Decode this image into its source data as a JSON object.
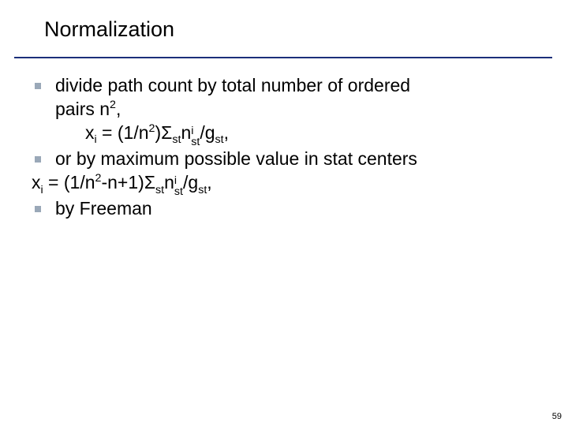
{
  "title": "Normalization",
  "bullets": {
    "b1_l1": "divide path count by total number of ordered",
    "b1_l2_prefix": "pairs n",
    "b1_l2_sup": "2",
    "b1_l2_suffix": ",",
    "f1_prefix": "x",
    "f1_i": "i",
    "f1_eq": " = (1/n",
    "f1_n2": "2",
    "f1_rpar": ")",
    "f1_sigma": "Σ",
    "f1_sig_sub": "st",
    "f1_n": "n",
    "f1_n_sup": "i",
    "f1_n_sub": "st",
    "f1_over": "/g",
    "f1_g_sub": "st",
    "f1_end": ",",
    "b2": "or by maximum possible value in stat centers",
    "f2_prefix": "x",
    "f2_i": "i",
    "f2_eq": " = (1/n",
    "f2_n2": "2",
    "f2_mid": "-n+1)",
    "f2_sigma": "Σ",
    "f2_sig_sub": "st",
    "f2_n": "n",
    "f2_n_sup": "i",
    "f2_n_sub": "st",
    "f2_over": "/g",
    "f2_g_sub": "st",
    "f2_end": ",",
    "b3": "by Freeman"
  },
  "page_number": "59"
}
